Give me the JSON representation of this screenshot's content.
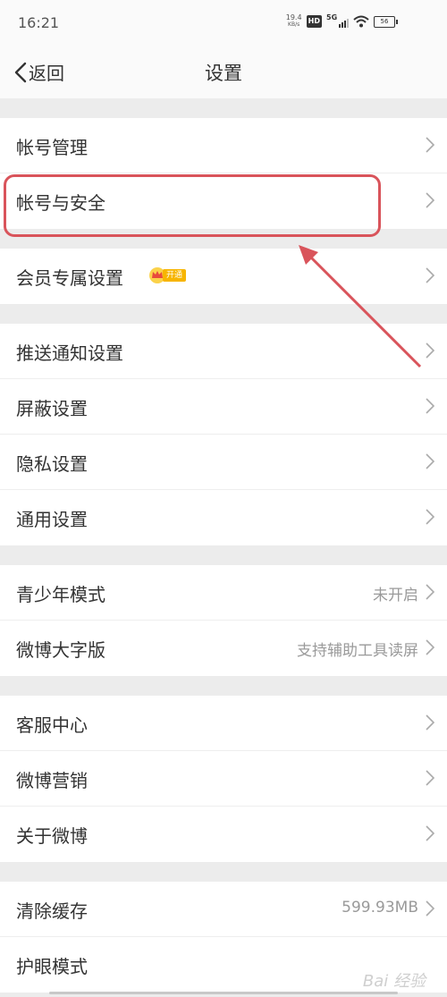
{
  "status_bar": {
    "time": "16:21",
    "net_speed_value": "19.4",
    "net_speed_unit": "KB/s",
    "hd_label": "HD",
    "network_label": "5G",
    "battery_level": "56"
  },
  "nav": {
    "back_label": "返回",
    "title": "设置"
  },
  "groups": [
    {
      "items": [
        {
          "label": "帐号管理"
        },
        {
          "label": "帐号与安全"
        }
      ]
    },
    {
      "items": [
        {
          "label": "会员专属设置",
          "badge": "开通"
        }
      ]
    },
    {
      "items": [
        {
          "label": "推送通知设置"
        },
        {
          "label": "屏蔽设置"
        },
        {
          "label": "隐私设置"
        },
        {
          "label": "通用设置"
        }
      ]
    },
    {
      "items": [
        {
          "label": "青少年模式",
          "value": "未开启"
        },
        {
          "label": "微博大字版",
          "value": "支持辅助工具读屏"
        }
      ]
    },
    {
      "items": [
        {
          "label": "客服中心"
        },
        {
          "label": "微博营销"
        },
        {
          "label": "关于微博"
        }
      ]
    },
    {
      "items": [
        {
          "label": "清除缓存",
          "value": "599.93MB"
        },
        {
          "label": "护眼模式"
        }
      ]
    }
  ],
  "annotation": {
    "highlight_color": "#d9545b"
  },
  "watermark_text": "Bai 经验"
}
